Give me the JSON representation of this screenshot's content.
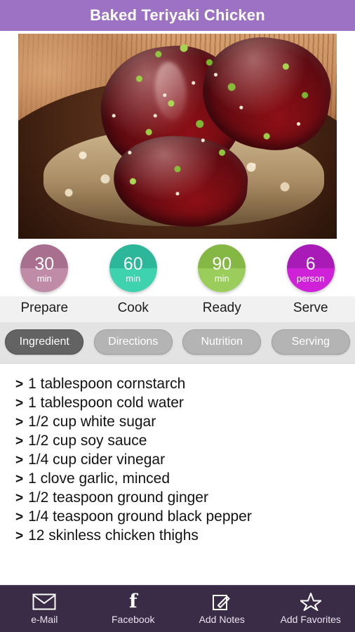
{
  "header": {
    "title": "Baked Teriyaki Chicken",
    "bg_color": "#9d71c3"
  },
  "hero": {
    "alt": "baked teriyaki chicken glazed with sauce over rice, topped with green onions and sesame seeds"
  },
  "meta": [
    {
      "value": "30",
      "unit": "min",
      "label": "Prepare",
      "color_top": "#a96f8e",
      "color_bottom": "#bf8ba6"
    },
    {
      "value": "60",
      "unit": "min",
      "label": "Cook",
      "color_top": "#2cb79a",
      "color_bottom": "#3ed2af"
    },
    {
      "value": "90",
      "unit": "min",
      "label": "Ready",
      "color_top": "#84b744",
      "color_bottom": "#9bcd5c"
    },
    {
      "value": "6",
      "unit": "person",
      "label": "Serve",
      "color_top": "#a81bb6",
      "color_bottom": "#cf22d8"
    }
  ],
  "tabs": [
    {
      "label": "Ingredient",
      "active": true
    },
    {
      "label": "Directions",
      "active": false
    },
    {
      "label": "Nutrition",
      "active": false
    },
    {
      "label": "Serving",
      "active": false
    }
  ],
  "ingredients": {
    "marker": ">",
    "items": [
      "1 tablespoon cornstarch",
      "1 tablespoon cold water",
      "1/2 cup white sugar",
      "1/2 cup soy sauce",
      "1/4 cup cider vinegar",
      "1 clove garlic, minced",
      "1/2 teaspoon ground ginger",
      "1/4 teaspoon ground black pepper",
      "12 skinless chicken thighs"
    ]
  },
  "bottom_bar": {
    "bg_color": "#3a2c46",
    "items": [
      {
        "label": "e-Mail",
        "icon": "envelope-icon"
      },
      {
        "label": "Facebook",
        "icon": "facebook-icon"
      },
      {
        "label": "Add Notes",
        "icon": "note-pencil-icon"
      },
      {
        "label": "Add Favorites",
        "icon": "star-icon"
      }
    ]
  }
}
